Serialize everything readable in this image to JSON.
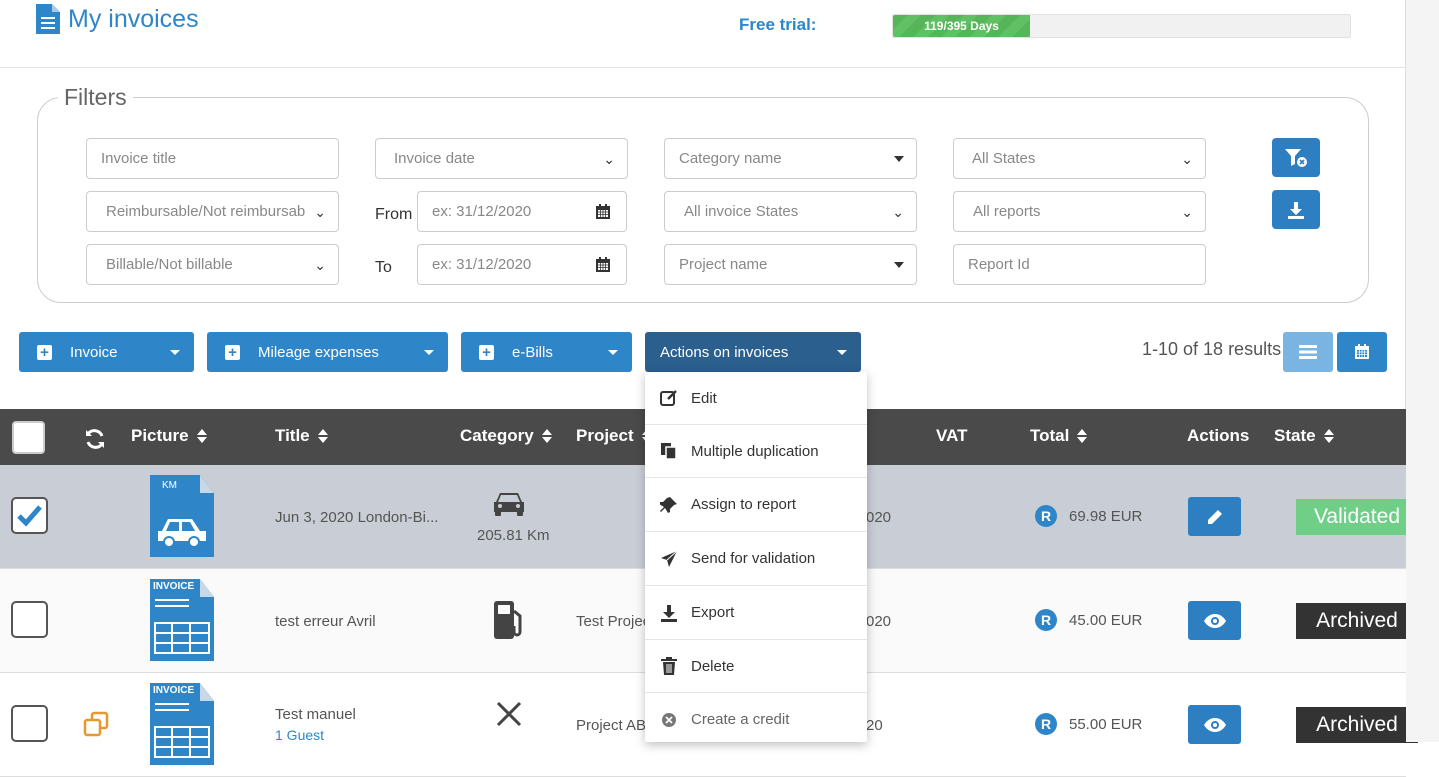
{
  "header": {
    "title": "My invoices",
    "trial_label": "Free trial:",
    "trial_progress_text": "119/395 Days",
    "trial_progress_fraction": 0.301
  },
  "filters": {
    "legend": "Filters",
    "invoice_title_placeholder": "Invoice title",
    "invoice_date": "Invoice date",
    "category_name": "Category name",
    "all_states": "All States",
    "reimbursable": "Reimbursable/Not reimbursab",
    "from_label": "From",
    "from_placeholder": "ex: 31/12/2020",
    "all_invoice_states": "All invoice States",
    "all_reports": "All reports",
    "billable": "Billable/Not billable",
    "to_label": "To",
    "to_placeholder": "ex: 31/12/2020",
    "project_name": "Project name",
    "report_id_placeholder": "Report Id"
  },
  "toolbar": {
    "invoice": "Invoice",
    "mileage": "Mileage expenses",
    "ebills": "e-Bills",
    "actions": "Actions on invoices",
    "results": "1-10 of 18 results"
  },
  "table": {
    "headers": {
      "picture": "Picture",
      "title": "Title",
      "category": "Category",
      "project": "Project",
      "vat": "VAT",
      "total": "Total",
      "actions": "Actions",
      "state": "State"
    },
    "rows": [
      {
        "doc_label": "KM",
        "title": "Jun 3, 2020 London-Bi...",
        "category_text": "205.81 Km",
        "project": "",
        "date_frag": "020",
        "total": "69.98 EUR",
        "state": "Validated",
        "checked": true
      },
      {
        "doc_label": "INVOICE",
        "title": "test erreur Avril",
        "category_text": "",
        "project": "Test Projec",
        "date_frag": "020",
        "total": "45.00 EUR",
        "state": "Archived",
        "checked": false
      },
      {
        "doc_label": "INVOICE",
        "title": "Test manuel",
        "subtitle": "1 Guest",
        "category_text": "",
        "project": "Project AB",
        "date_frag": "20",
        "total": "55.00 EUR",
        "state": "Archived",
        "checked": false
      }
    ],
    "currency_badge": "R"
  },
  "dropdown": {
    "items": [
      "Edit",
      "Multiple duplication",
      "Assign to report",
      "Send for validation",
      "Export",
      "Delete",
      "Create a credit"
    ]
  },
  "colors": {
    "primary": "#2e86c9",
    "validated": "#6fcf87",
    "archived": "#333333",
    "header_bg": "#4a4a4a"
  }
}
